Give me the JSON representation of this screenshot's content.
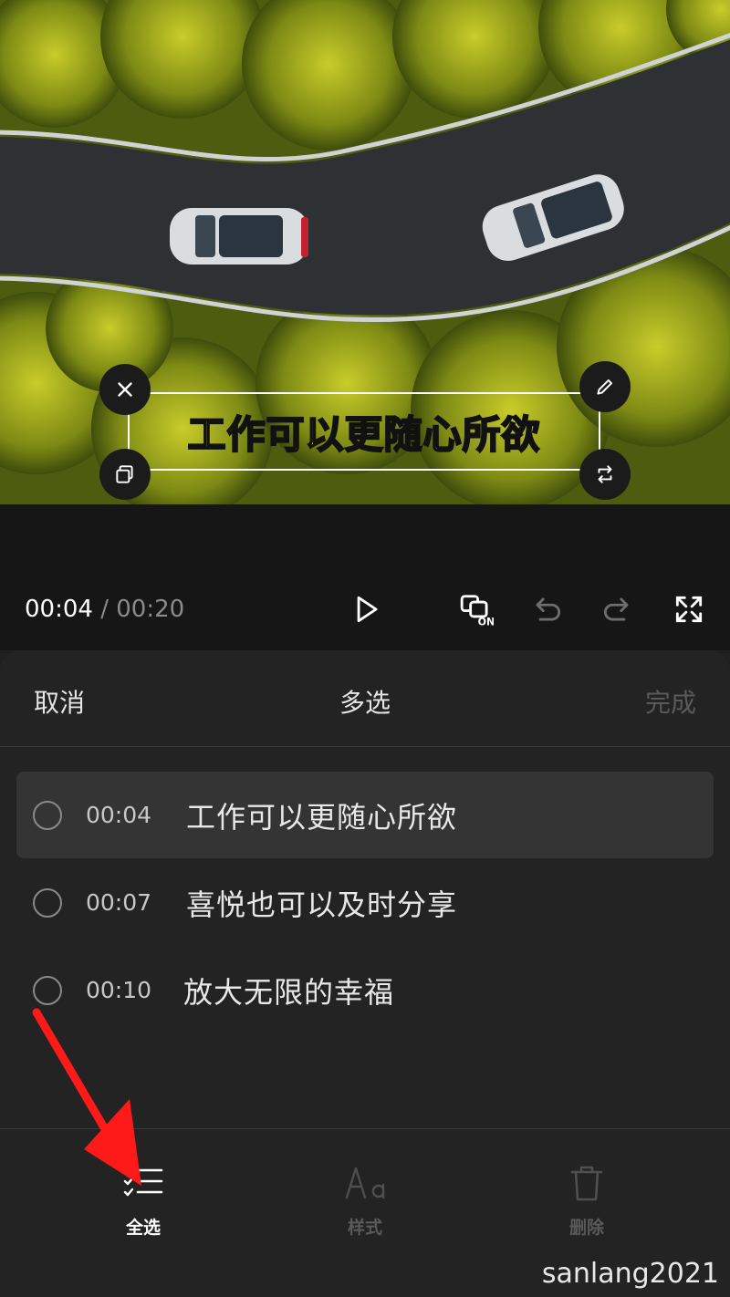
{
  "preview": {
    "subtitle": "工作可以更随心所欲",
    "handles": {
      "delete": "close-icon",
      "edit": "pencil-icon",
      "copy": "copy-icon",
      "rotate": "rotate-icon"
    }
  },
  "playback": {
    "current_time": "00:04",
    "separator": "/",
    "total_time": "00:20",
    "icons": [
      "play-icon",
      "keyframe-on-icon",
      "undo-icon",
      "redo-icon",
      "fullscreen-icon"
    ],
    "toggle_badge": "ON"
  },
  "panel": {
    "cancel": "取消",
    "title": "多选",
    "done": "完成",
    "items": [
      {
        "time": "00:04",
        "text": "工作可以更随心所欲",
        "highlighted": true
      },
      {
        "time": "00:07",
        "text": "喜悦也可以及时分享",
        "highlighted": false
      },
      {
        "time": "00:10",
        "text": "放大无限的幸福",
        "highlighted": false
      }
    ],
    "tools": [
      {
        "label": "全选",
        "icon": "select-all-icon",
        "enabled": true
      },
      {
        "label": "样式",
        "icon": "text-style-icon",
        "enabled": false
      },
      {
        "label": "删除",
        "icon": "trash-icon",
        "enabled": false
      }
    ]
  },
  "watermark": "sanlang2021",
  "colors": {
    "subtitle_fill": "#ffe23a",
    "annotation_arrow": "#ff1a1a",
    "panel_bg": "#232323"
  }
}
